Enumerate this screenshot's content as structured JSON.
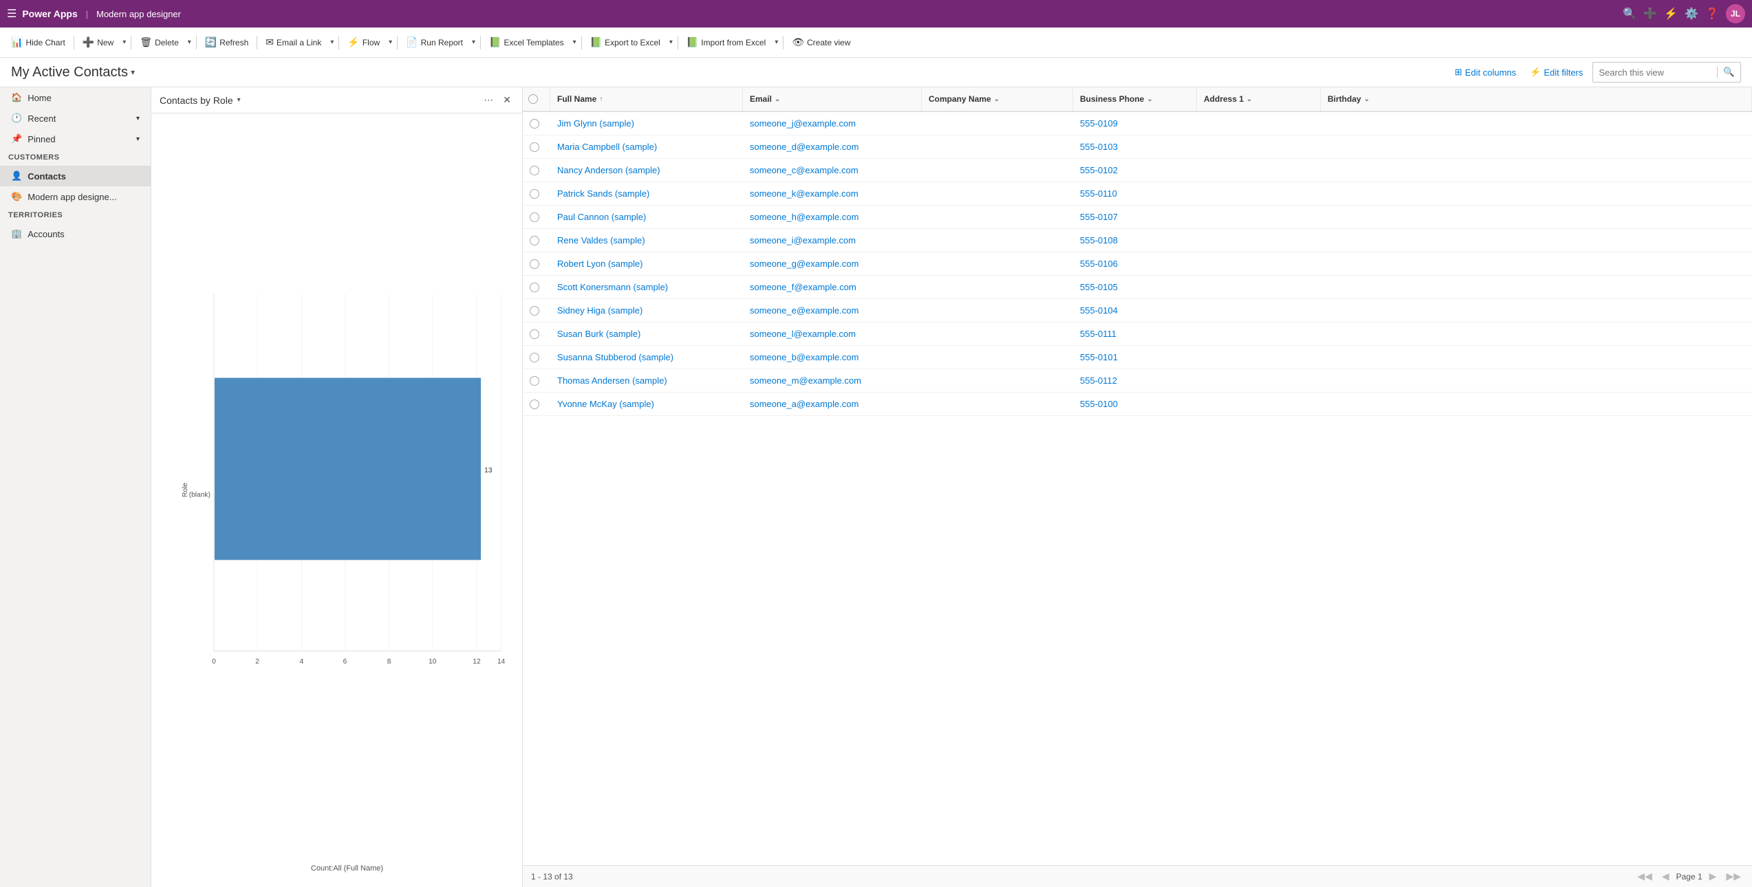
{
  "topbar": {
    "app_name": "Power Apps",
    "separator": "|",
    "app_title": "Modern app designer",
    "avatar_initials": "JL"
  },
  "commandbar": {
    "hide_chart": "Hide Chart",
    "new": "New",
    "delete": "Delete",
    "refresh": "Refresh",
    "email_link": "Email a Link",
    "flow": "Flow",
    "run_report": "Run Report",
    "excel_templates": "Excel Templates",
    "export_excel": "Export to Excel",
    "import_excel": "Import from Excel",
    "create_view": "Create view"
  },
  "subheader": {
    "view_title": "My Active Contacts",
    "edit_columns": "Edit columns",
    "edit_filters": "Edit filters",
    "search_placeholder": "Search this view"
  },
  "sidebar": {
    "nav_items": [
      {
        "label": "Home",
        "icon": "🏠"
      },
      {
        "label": "Recent",
        "icon": "🕐",
        "has_chevron": true
      },
      {
        "label": "Pinned",
        "icon": "📌",
        "has_chevron": true
      }
    ],
    "customers_section": "Customers",
    "customers_items": [
      {
        "label": "Contacts",
        "icon": "👤",
        "active": true
      },
      {
        "label": "Modern app designe...",
        "icon": "🎨"
      }
    ],
    "territories_section": "Territories",
    "territories_items": [
      {
        "label": "Accounts",
        "icon": "🏢"
      }
    ]
  },
  "chart": {
    "title": "Contacts by Role",
    "x_label": "Count:All (Full Name)",
    "y_label": "Role",
    "blank_label": "(blank)",
    "bar_value": 13,
    "x_axis_ticks": [
      0,
      2,
      4,
      6,
      8,
      10,
      12,
      14
    ],
    "bar_color": "#4e8cbf"
  },
  "grid": {
    "columns": [
      {
        "key": "checkbox",
        "label": ""
      },
      {
        "key": "fullname",
        "label": "Full Name",
        "sortable": true,
        "sort_dir": "asc"
      },
      {
        "key": "email",
        "label": "Email",
        "sortable": true
      },
      {
        "key": "company",
        "label": "Company Name",
        "sortable": true
      },
      {
        "key": "phone",
        "label": "Business Phone",
        "sortable": true
      },
      {
        "key": "address",
        "label": "Address 1",
        "sortable": true
      },
      {
        "key": "birthday",
        "label": "Birthday",
        "sortable": true
      }
    ],
    "rows": [
      {
        "fullname": "Jim Glynn (sample)",
        "email": "someone_j@example.com",
        "company": "",
        "phone": "555-0109",
        "address": "",
        "birthday": ""
      },
      {
        "fullname": "Maria Campbell (sample)",
        "email": "someone_d@example.com",
        "company": "",
        "phone": "555-0103",
        "address": "",
        "birthday": ""
      },
      {
        "fullname": "Nancy Anderson (sample)",
        "email": "someone_c@example.com",
        "company": "",
        "phone": "555-0102",
        "address": "",
        "birthday": ""
      },
      {
        "fullname": "Patrick Sands (sample)",
        "email": "someone_k@example.com",
        "company": "",
        "phone": "555-0110",
        "address": "",
        "birthday": ""
      },
      {
        "fullname": "Paul Cannon (sample)",
        "email": "someone_h@example.com",
        "company": "",
        "phone": "555-0107",
        "address": "",
        "birthday": ""
      },
      {
        "fullname": "Rene Valdes (sample)",
        "email": "someone_i@example.com",
        "company": "",
        "phone": "555-0108",
        "address": "",
        "birthday": ""
      },
      {
        "fullname": "Robert Lyon (sample)",
        "email": "someone_g@example.com",
        "company": "",
        "phone": "555-0106",
        "address": "",
        "birthday": ""
      },
      {
        "fullname": "Scott Konersmann (sample)",
        "email": "someone_f@example.com",
        "company": "",
        "phone": "555-0105",
        "address": "",
        "birthday": ""
      },
      {
        "fullname": "Sidney Higa (sample)",
        "email": "someone_e@example.com",
        "company": "",
        "phone": "555-0104",
        "address": "",
        "birthday": ""
      },
      {
        "fullname": "Susan Burk (sample)",
        "email": "someone_l@example.com",
        "company": "",
        "phone": "555-0111",
        "address": "",
        "birthday": ""
      },
      {
        "fullname": "Susanna Stubberod (sample)",
        "email": "someone_b@example.com",
        "company": "",
        "phone": "555-0101",
        "address": "",
        "birthday": ""
      },
      {
        "fullname": "Thomas Andersen (sample)",
        "email": "someone_m@example.com",
        "company": "",
        "phone": "555-0112",
        "address": "",
        "birthday": ""
      },
      {
        "fullname": "Yvonne McKay (sample)",
        "email": "someone_a@example.com",
        "company": "",
        "phone": "555-0100",
        "address": "",
        "birthday": ""
      }
    ],
    "footer_text": "1 - 13 of 13",
    "page_label": "Page 1"
  }
}
